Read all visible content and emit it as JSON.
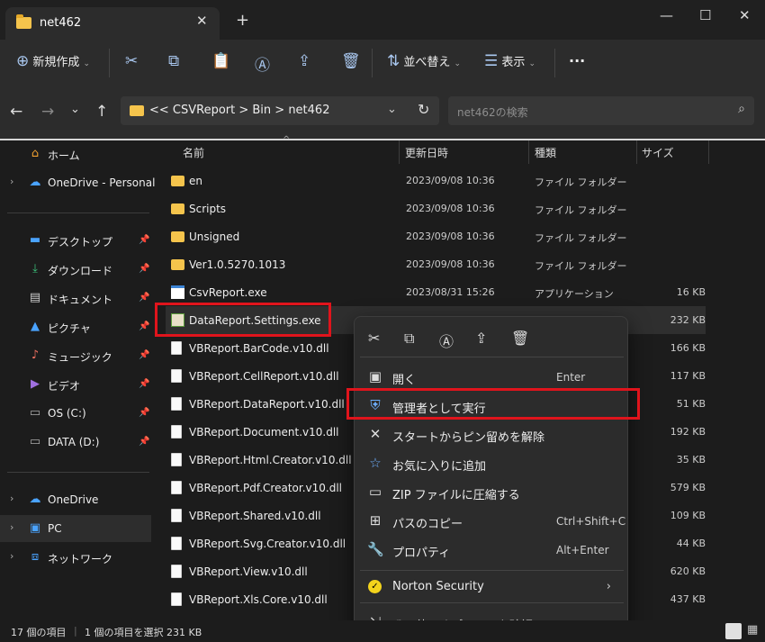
{
  "window": {
    "tab_title": "net462",
    "close_tab": "✕",
    "new_tab": "+",
    "minimize": "—",
    "maximize": "☐",
    "close": "✕"
  },
  "toolbar": {
    "new_label": "新規作成",
    "sort_label": "並べ替え",
    "view_label": "表示",
    "more": "···"
  },
  "address": {
    "crumbs": "<<  CSVReport  >  Bin  >  net462",
    "search_placeholder": "net462の検索"
  },
  "sidebar": {
    "items": [
      {
        "label": "ホーム",
        "icon": "home-icon"
      },
      {
        "label": "OneDrive - Personal",
        "icon": "cloud-icon"
      },
      {
        "label": "デスクトップ",
        "icon": "desktop-icon"
      },
      {
        "label": "ダウンロード",
        "icon": "download-icon"
      },
      {
        "label": "ドキュメント",
        "icon": "document-icon"
      },
      {
        "label": "ピクチャ",
        "icon": "pictures-icon"
      },
      {
        "label": "ミュージック",
        "icon": "music-icon"
      },
      {
        "label": "ビデオ",
        "icon": "video-icon"
      },
      {
        "label": "OS (C:)",
        "icon": "drive-icon"
      },
      {
        "label": "DATA (D:)",
        "icon": "drive-icon"
      },
      {
        "label": "OneDrive",
        "icon": "cloud-icon"
      },
      {
        "label": "PC",
        "icon": "pc-icon"
      },
      {
        "label": "ネットワーク",
        "icon": "network-icon"
      }
    ]
  },
  "columns": {
    "name": "名前",
    "date": "更新日時",
    "type": "種類",
    "size": "サイズ"
  },
  "files": [
    {
      "name": "en",
      "date": "2023/09/08 10:36",
      "type": "ファイル フォルダー",
      "size": "",
      "kind": "folder"
    },
    {
      "name": "Scripts",
      "date": "2023/09/08 10:36",
      "type": "ファイル フォルダー",
      "size": "",
      "kind": "folder"
    },
    {
      "name": "Unsigned",
      "date": "2023/09/08 10:36",
      "type": "ファイル フォルダー",
      "size": "",
      "kind": "folder"
    },
    {
      "name": "Ver1.0.5270.1013",
      "date": "2023/09/08 10:36",
      "type": "ファイル フォルダー",
      "size": "",
      "kind": "folder"
    },
    {
      "name": "CsvReport.exe",
      "date": "2023/08/31 15:26",
      "type": "アプリケーション",
      "size": "16 KB",
      "kind": "exe"
    },
    {
      "name": "DataReport.Settings.exe",
      "date": "",
      "type": "",
      "size": "232 KB",
      "kind": "cfg"
    },
    {
      "name": "VBReport.BarCode.v10.dll",
      "date": "",
      "type": "",
      "size": "166 KB",
      "kind": "dll"
    },
    {
      "name": "VBReport.CellReport.v10.dll",
      "date": "",
      "type": "",
      "size": "117 KB",
      "kind": "dll"
    },
    {
      "name": "VBReport.DataReport.v10.dll",
      "date": "",
      "type": "",
      "size": "51 KB",
      "kind": "dll"
    },
    {
      "name": "VBReport.Document.v10.dll",
      "date": "",
      "type": "",
      "size": "192 KB",
      "kind": "dll"
    },
    {
      "name": "VBReport.Html.Creator.v10.dll",
      "date": "",
      "type": "",
      "size": "35 KB",
      "kind": "dll"
    },
    {
      "name": "VBReport.Pdf.Creator.v10.dll",
      "date": "",
      "type": "",
      "size": "579 KB",
      "kind": "dll"
    },
    {
      "name": "VBReport.Shared.v10.dll",
      "date": "",
      "type": "",
      "size": "109 KB",
      "kind": "dll"
    },
    {
      "name": "VBReport.Svg.Creator.v10.dll",
      "date": "",
      "type": "",
      "size": "44 KB",
      "kind": "dll"
    },
    {
      "name": "VBReport.View.v10.dll",
      "date": "",
      "type": "",
      "size": "620 KB",
      "kind": "dll"
    },
    {
      "name": "VBReport.Xls.Core.v10.dll",
      "date": "",
      "type": "",
      "size": "437 KB",
      "kind": "dll"
    }
  ],
  "context_menu": {
    "items": [
      {
        "label": "開く",
        "accel": "Enter",
        "icon": "open-icon"
      },
      {
        "label": "管理者として実行",
        "accel": "",
        "icon": "shield-icon"
      },
      {
        "label": "スタートからピン留めを解除",
        "accel": "",
        "icon": "unpin-icon"
      },
      {
        "label": "お気に入りに追加",
        "accel": "",
        "icon": "star-icon"
      },
      {
        "label": "ZIP ファイルに圧縮する",
        "accel": "",
        "icon": "zip-icon"
      },
      {
        "label": "パスのコピー",
        "accel": "Ctrl+Shift+C",
        "icon": "copy-path-icon"
      },
      {
        "label": "プロパティ",
        "accel": "Alt+Enter",
        "icon": "wrench-icon"
      },
      {
        "label": "Norton Security",
        "accel": "",
        "icon": "norton-icon"
      },
      {
        "label": "その他のオプションを確認",
        "accel": "",
        "icon": "more-options-icon"
      }
    ]
  },
  "status": {
    "count": "17 個の項目",
    "selected": "1 個の項目を選択  231 KB"
  },
  "colors": {
    "highlight": "#e0141c",
    "folder": "#f5c44c",
    "background": "#1c1c1c"
  }
}
